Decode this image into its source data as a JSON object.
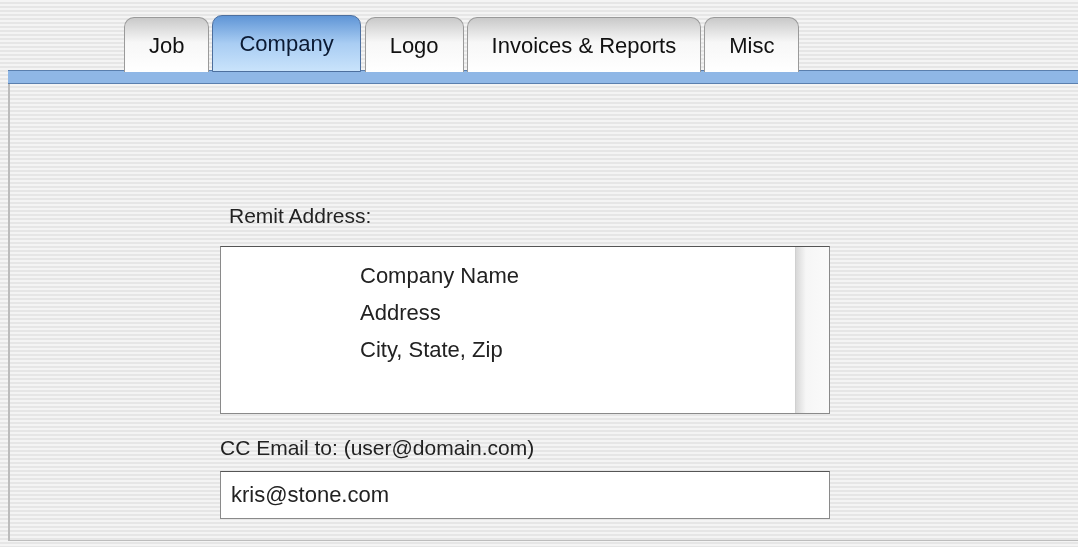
{
  "tabs": [
    {
      "label": "Job",
      "selected": false
    },
    {
      "label": "Company",
      "selected": true
    },
    {
      "label": "Logo",
      "selected": false
    },
    {
      "label": "Invoices & Reports",
      "selected": false
    },
    {
      "label": "Misc",
      "selected": false
    }
  ],
  "remit_address": {
    "label": "Remit Address:",
    "lines": [
      "Company Name",
      "Address",
      "City, State, Zip"
    ]
  },
  "cc_email": {
    "label": "CC Email to: (user@domain.com)",
    "value": "kris@stone.com"
  }
}
